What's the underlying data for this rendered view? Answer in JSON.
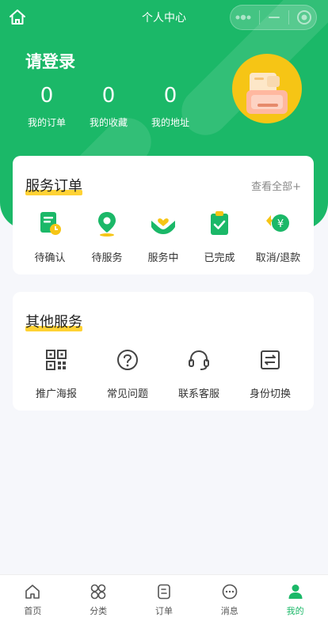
{
  "header": {
    "title": "个人中心",
    "login_text": "请登录",
    "stats": [
      {
        "value": "0",
        "label": "我的订单"
      },
      {
        "value": "0",
        "label": "我的收藏"
      },
      {
        "value": "0",
        "label": "我的地址"
      }
    ],
    "accent": "#1bb868"
  },
  "service_orders": {
    "title": "服务订单",
    "see_all": "查看全部+",
    "items": [
      {
        "label": "待确认",
        "icon": "pending-confirm-icon"
      },
      {
        "label": "待服务",
        "icon": "location-pin-icon"
      },
      {
        "label": "服务中",
        "icon": "hands-heart-icon"
      },
      {
        "label": "已完成",
        "icon": "clipboard-check-icon"
      },
      {
        "label": "取消/退款",
        "icon": "refund-yen-icon"
      }
    ]
  },
  "other_services": {
    "title": "其他服务",
    "items": [
      {
        "label": "推广海报",
        "icon": "qr-code-icon"
      },
      {
        "label": "常见问题",
        "icon": "question-circle-icon"
      },
      {
        "label": "联系客服",
        "icon": "headset-icon"
      },
      {
        "label": "身份切换",
        "icon": "switch-icon"
      }
    ]
  },
  "tabbar": {
    "tabs": [
      {
        "label": "首页",
        "icon": "home-icon"
      },
      {
        "label": "分类",
        "icon": "grid-icon"
      },
      {
        "label": "订单",
        "icon": "order-icon"
      },
      {
        "label": "消息",
        "icon": "message-icon"
      },
      {
        "label": "我的",
        "icon": "user-icon",
        "active": true
      }
    ]
  }
}
